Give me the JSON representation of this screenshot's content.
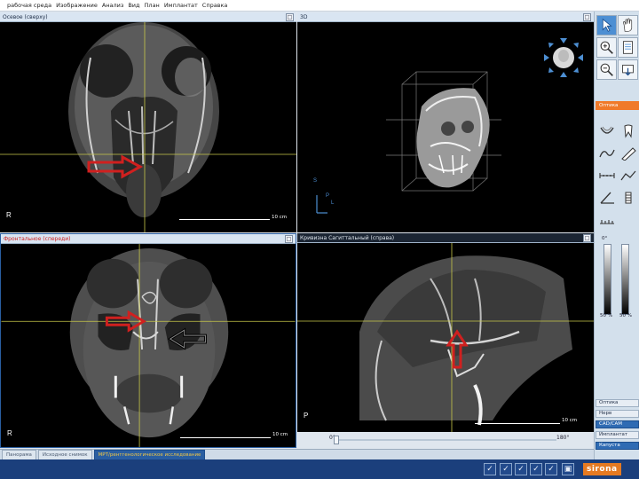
{
  "menu": [
    "рабочая среда",
    "Изображение",
    "Анализ",
    "Вид",
    "План",
    "Имплантат",
    "Справка"
  ],
  "viewports": {
    "axial": {
      "title": "Осевое (сверху)",
      "orient": "R",
      "scale": "10 cm"
    },
    "view3d": {
      "title": "3D",
      "orient_s": "S",
      "orient_p": "P",
      "orient_l": "L"
    },
    "frontal": {
      "title": "Фронтальное (спереди)",
      "orient": "R",
      "scale": "10 cm"
    },
    "sagittal": {
      "title": "Кривизна   Сагиттальный (справа)",
      "orient": "P",
      "scale": "10 cm",
      "slider_start": "0°",
      "slider_end": "180°"
    }
  },
  "sidebar": {
    "section_tab": "Оптика",
    "range_top": "0°",
    "range_bottom": "180°",
    "pct_left": "50 %",
    "pct_right": "50 %",
    "buttons": [
      "Оптика",
      "Нерв",
      "CAD/CAM",
      "Имплантат",
      "Капуста"
    ]
  },
  "bottom_tabs": [
    "Панорама",
    "Исходное снимок",
    "МРТ/рентгенологическое исследование"
  ],
  "status": {
    "brand": "sirona",
    "icons": [
      "tool-a-icon",
      "tool-b-icon",
      "tool-c-icon",
      "tool-d-icon",
      "tool-e-icon",
      "tool-f-icon"
    ]
  },
  "colors": {
    "accent": "#f07a2a",
    "status_bar": "#1b3f7c",
    "arrow_red": "#d0201f",
    "crosshair": "#c8c84a"
  }
}
